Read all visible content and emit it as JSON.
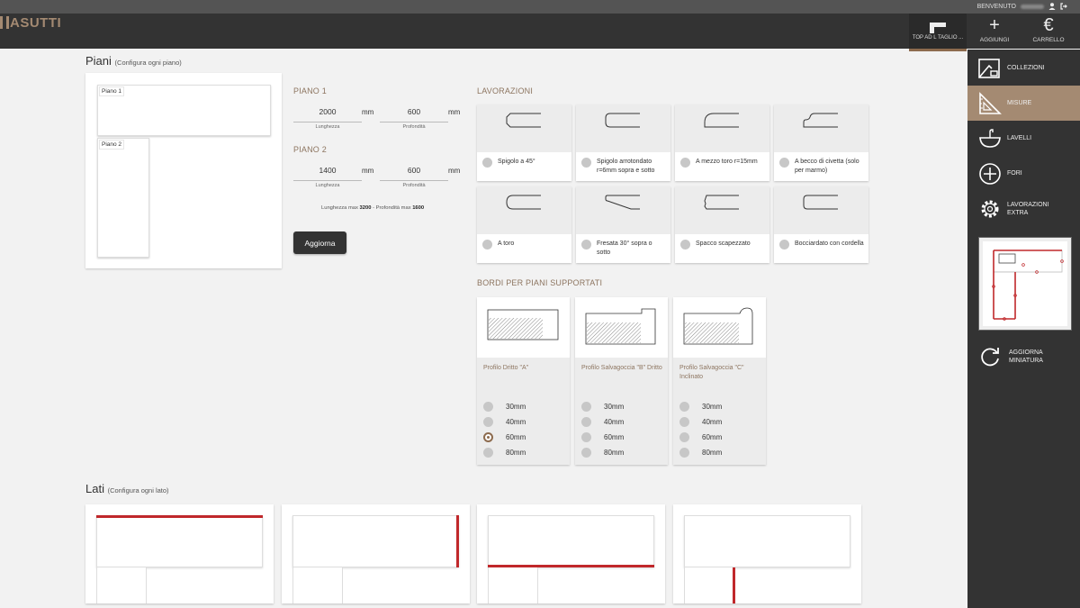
{
  "header": {
    "welcome_label": "BENVENUTO",
    "logo_text": "ASUTTI",
    "active_tab_label": "TOP AD L TAGLIO ...",
    "add_label": "AGGIUNGI",
    "cart_label": "CARRELLO",
    "add_glyph": "+",
    "cart_glyph": "€"
  },
  "sidebar": {
    "items": [
      {
        "label": "COLLEZIONI",
        "icon": "collections-icon"
      },
      {
        "label": "MISURE",
        "icon": "set-square-icon",
        "active": true
      },
      {
        "label": "LAVELLI",
        "icon": "sink-icon"
      },
      {
        "label": "FORI",
        "icon": "plus-circle-icon"
      },
      {
        "label": "LAVORAZIONI EXTRA",
        "icon": "gear-icon"
      }
    ],
    "refresh_label": "AGGIORNA MINIATURA"
  },
  "piani": {
    "title": "Piani",
    "subtitle": "(Configura ogni piano)",
    "tags": [
      "Piano 1",
      "Piano 2"
    ],
    "piano1": {
      "heading": "PIANO 1",
      "length": "2000",
      "depth": "600"
    },
    "piano2": {
      "heading": "PIANO 2",
      "length": "1400",
      "depth": "600"
    },
    "unit": "mm",
    "length_caption": "Lunghezza",
    "depth_caption": "Profondità",
    "max_note_prefix": "Lunghezza max ",
    "max_length": "3200",
    "max_note_mid": " - Profondità max ",
    "max_depth": "1600",
    "update_button": "Aggiorna"
  },
  "lavorazioni": {
    "heading": "LAVORAZIONI",
    "options": [
      "Spigolo a 45°",
      "Spigolo arrotondato r=6mm sopra e sotto",
      "A mezzo toro r=15mm",
      "A becco di civetta (solo per marmo)",
      "A toro",
      "Fresata 30° sopra o sotto",
      "Spacco scapezzato",
      "Bocciardato con cordella"
    ]
  },
  "bordi": {
    "heading": "BORDI PER PIANI SUPPORTATI",
    "profiles": [
      {
        "name": "Profilo Dritto \"A\"",
        "options": [
          "30mm",
          "40mm",
          "60mm",
          "80mm"
        ],
        "selected": 2
      },
      {
        "name": "Profilo Salvagoccia \"B\" Dritto",
        "options": [
          "30mm",
          "40mm",
          "60mm",
          "80mm"
        ],
        "selected": -1
      },
      {
        "name": "Profilo Salvagoccia \"C\" Inclinato",
        "options": [
          "30mm",
          "40mm",
          "60mm",
          "80mm"
        ],
        "selected": -1
      }
    ]
  },
  "lati": {
    "title": "Lati",
    "subtitle": "(Configura ogni lato)"
  },
  "colors": {
    "accent": "#a48a72",
    "dark": "#333333",
    "red_edge": "#c0282b"
  }
}
